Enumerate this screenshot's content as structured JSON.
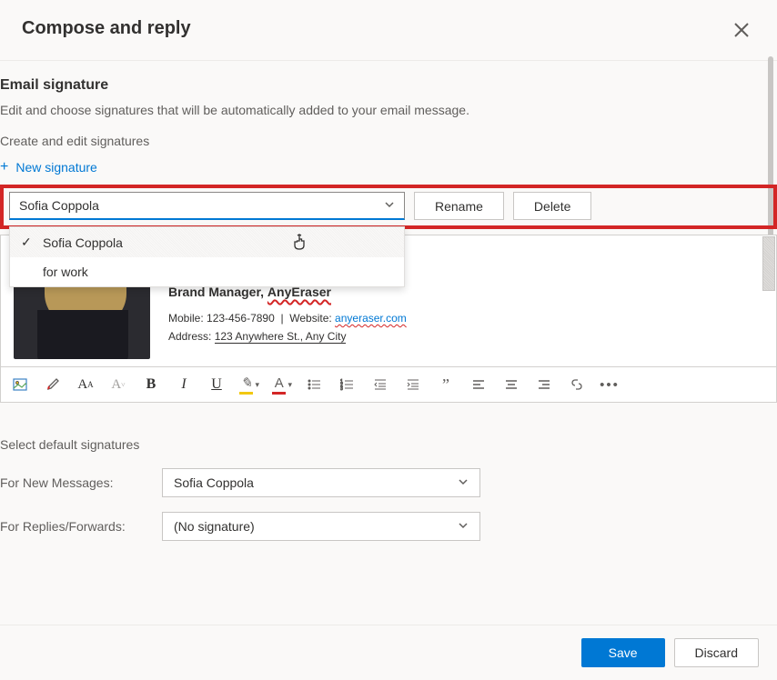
{
  "header": {
    "title": "Compose and reply"
  },
  "section": {
    "heading": "Email signature",
    "description": "Edit and choose signatures that will be automatically added to your email message.",
    "create_edit_label": "Create and edit signatures",
    "new_signature_label": "New signature"
  },
  "signature_picker": {
    "selected": "Sofia Coppola",
    "options": [
      {
        "label": "Sofia Coppola",
        "selected": true
      },
      {
        "label": "for work",
        "selected": false
      }
    ],
    "rename_label": "Rename",
    "delete_label": "Delete"
  },
  "signature_preview": {
    "job_title": "Brand Manager,",
    "company": "AnyEraser",
    "mobile_label": "Mobile:",
    "mobile_value": "123-456-7890",
    "divider": "|",
    "website_label": "Website:",
    "website_value": "anyeraser.com",
    "address_label": "Address:",
    "address_value": "123 Anywhere St., Any City"
  },
  "toolbar_letters": {
    "bold": "B",
    "italic": "I",
    "underline": "U",
    "font_a": "A",
    "highlight_symbol": "✎",
    "quote": "”"
  },
  "defaults": {
    "heading": "Select default signatures",
    "new_messages_label": "For New Messages:",
    "new_messages_value": "Sofia Coppola",
    "replies_label": "For Replies/Forwards:",
    "replies_value": "(No signature)"
  },
  "footer": {
    "save": "Save",
    "discard": "Discard"
  }
}
